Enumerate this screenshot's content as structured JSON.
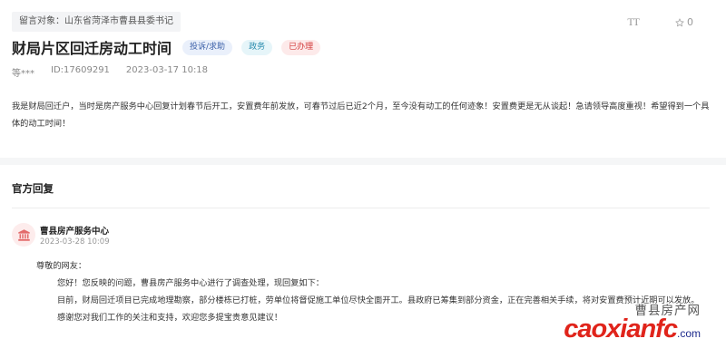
{
  "header": {
    "target_label": "留言对象：山东省菏泽市曹县县委书记",
    "font_toggle_label": "TT",
    "favorite_count": "0"
  },
  "message": {
    "title": "财局片区回迁房动工时间",
    "tags": {
      "category": "投诉/求助",
      "type": "政务",
      "status": "已办理"
    },
    "author": "等***",
    "id": "ID:17609291",
    "date": "2023-03-17 10:18",
    "content": "我是财局回迁户，当时是房产服务中心回复计划春节后开工，安置费年前发放，可春节过后已近2个月，至今没有动工的任何迹象！安置费更是无从谈起！急请领导高度重视！希望得到一个具体的动工时间！"
  },
  "reply": {
    "heading": "官方回复",
    "department": "曹县房产服务中心",
    "time": "2023-03-28 10:09",
    "greeting": "尊敬的网友：",
    "para1": "您好！您反映的问题，曹县房产服务中心进行了调查处理，现回复如下：",
    "para2": "目前，财局回迁项目已完成地理勘察，部分楼栋已打桩，劳单位将督促施工单位尽快全面开工。县政府已筹集到部分资金，正在完善相关手续，将对安置费预计近期可以发放。",
    "para3": "感谢您对我们工作的关注和支持，欢迎您多提宝贵意见建议！"
  },
  "watermark": {
    "site_cn": "曹县房产网",
    "domain_main": "caoxianfc",
    "domain_tld": ".com"
  },
  "colors": {
    "status_red": "#d33c3c",
    "watermark_red": "#e0241b",
    "watermark_blue": "#1d2a8c"
  }
}
